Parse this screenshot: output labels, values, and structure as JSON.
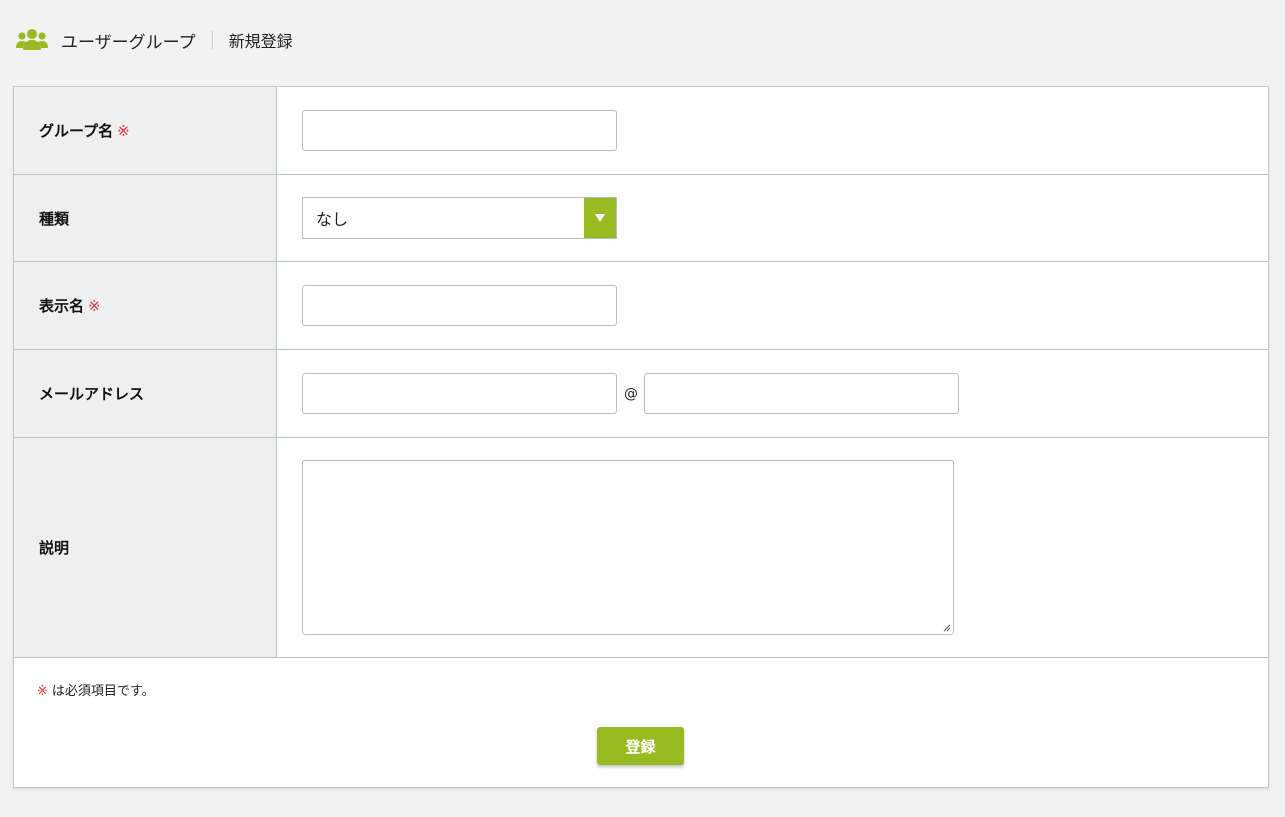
{
  "header": {
    "icon": "users-icon",
    "title": "ユーザーグループ",
    "subtitle": "新規登録"
  },
  "form": {
    "required_mark": "※",
    "group_name": {
      "label": "グループ名",
      "required": true,
      "value": ""
    },
    "type": {
      "label": "種類",
      "selected": "なし"
    },
    "display_name": {
      "label": "表示名",
      "required": true,
      "value": ""
    },
    "email": {
      "label": "メールアドレス",
      "local_value": "",
      "at": "@",
      "domain_value": ""
    },
    "description": {
      "label": "説明",
      "value": ""
    }
  },
  "footer": {
    "note_mark": "※",
    "note_text": "は必須項目です。",
    "submit_label": "登録"
  },
  "colors": {
    "accent": "#99bb22",
    "required": "#dd3333"
  }
}
